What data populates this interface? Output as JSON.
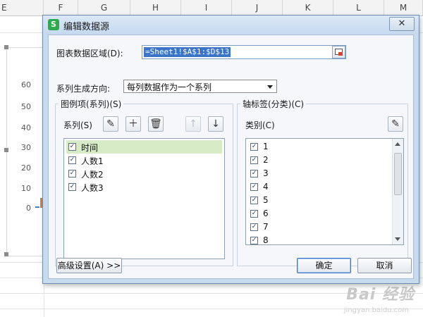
{
  "spreadsheet": {
    "columns": [
      "E",
      "F",
      "G",
      "H",
      "I",
      "J",
      "K",
      "L",
      "M"
    ],
    "y_ticks": [
      "60",
      "50",
      "40",
      "30",
      "20",
      "10",
      "0"
    ]
  },
  "watermark": {
    "main": "Bai 经验",
    "sub": "jingyan.baidu.com"
  },
  "dialog": {
    "title": "编辑数据源",
    "app_icon": "S",
    "close_label": "✕",
    "range_label": "图表数据区域(D):",
    "range_value": "=Sheet1!$A$1:$D$13",
    "direction_label": "系列生成方向:",
    "direction_value": "每列数据作为一个系列",
    "legend_group": {
      "title": "图例项(系列)(S)",
      "series_label": "系列(S)",
      "items": [
        {
          "label": "时间",
          "checked": true
        },
        {
          "label": "人数1",
          "checked": true
        },
        {
          "label": "人数2",
          "checked": true
        },
        {
          "label": "人数3",
          "checked": true
        }
      ]
    },
    "axis_group": {
      "title": "轴标签(分类)(C)",
      "category_label": "类别(C)",
      "items": [
        {
          "label": "1",
          "checked": true
        },
        {
          "label": "2",
          "checked": true
        },
        {
          "label": "3",
          "checked": true
        },
        {
          "label": "4",
          "checked": true
        },
        {
          "label": "5",
          "checked": true
        },
        {
          "label": "6",
          "checked": true
        },
        {
          "label": "7",
          "checked": true
        },
        {
          "label": "8",
          "checked": true
        }
      ]
    },
    "advanced_label": "高级设置(A) >>",
    "ok_label": "确定",
    "cancel_label": "取消"
  }
}
